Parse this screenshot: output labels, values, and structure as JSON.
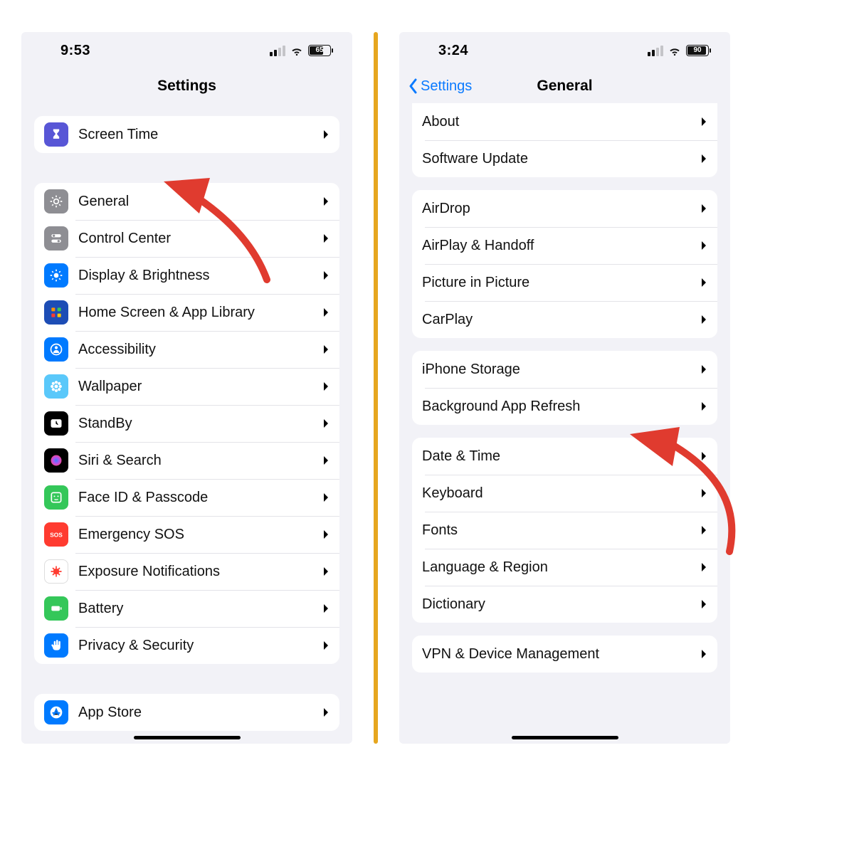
{
  "left": {
    "status": {
      "time": "9:53",
      "battery_pct": "65",
      "battery_fill_pct": 65,
      "signal_active_bars": 2
    },
    "title": "Settings",
    "group_top": [
      {
        "id": "screen-time",
        "label": "Screen Time",
        "bg": "bg-purple",
        "glyph": "hourglass"
      }
    ],
    "group_main": [
      {
        "id": "general",
        "label": "General",
        "bg": "bg-gray",
        "glyph": "gear"
      },
      {
        "id": "control-center",
        "label": "Control Center",
        "bg": "bg-gray",
        "glyph": "switches"
      },
      {
        "id": "display-brightness",
        "label": "Display & Brightness",
        "bg": "bg-blue",
        "glyph": "sun"
      },
      {
        "id": "home-screen",
        "label": "Home Screen & App Library",
        "bg": "bg-darkblue",
        "glyph": "grid"
      },
      {
        "id": "accessibility",
        "label": "Accessibility",
        "bg": "bg-blue",
        "glyph": "person"
      },
      {
        "id": "wallpaper",
        "label": "Wallpaper",
        "bg": "bg-teal",
        "glyph": "flower"
      },
      {
        "id": "standby",
        "label": "StandBy",
        "bg": "bg-black",
        "glyph": "clock"
      },
      {
        "id": "siri-search",
        "label": "Siri & Search",
        "bg": "bg-black",
        "glyph": "siri"
      },
      {
        "id": "face-id",
        "label": "Face ID & Passcode",
        "bg": "bg-green",
        "glyph": "face"
      },
      {
        "id": "emergency-sos",
        "label": "Emergency SOS",
        "bg": "bg-red",
        "glyph": "sos"
      },
      {
        "id": "exposure",
        "label": "Exposure Notifications",
        "bg": "bg-white",
        "glyph": "covid"
      },
      {
        "id": "battery",
        "label": "Battery",
        "bg": "bg-green",
        "glyph": "battery"
      },
      {
        "id": "privacy",
        "label": "Privacy & Security",
        "bg": "bg-blue",
        "glyph": "hand"
      }
    ],
    "group_bottom": [
      {
        "id": "app-store",
        "label": "App Store",
        "bg": "bg-blue",
        "glyph": "appstore"
      }
    ]
  },
  "right": {
    "status": {
      "time": "3:24",
      "battery_pct": "90",
      "battery_fill_pct": 90,
      "signal_active_bars": 2
    },
    "back_label": "Settings",
    "title": "General",
    "group1": [
      {
        "id": "about",
        "label": "About"
      },
      {
        "id": "software-update",
        "label": "Software Update"
      }
    ],
    "group2": [
      {
        "id": "airdrop",
        "label": "AirDrop"
      },
      {
        "id": "airplay",
        "label": "AirPlay & Handoff"
      },
      {
        "id": "pip",
        "label": "Picture in Picture"
      },
      {
        "id": "carplay",
        "label": "CarPlay"
      }
    ],
    "group3": [
      {
        "id": "storage",
        "label": "iPhone Storage"
      },
      {
        "id": "bg-refresh",
        "label": "Background App Refresh"
      }
    ],
    "group4": [
      {
        "id": "date-time",
        "label": "Date & Time"
      },
      {
        "id": "keyboard",
        "label": "Keyboard"
      },
      {
        "id": "fonts",
        "label": "Fonts"
      },
      {
        "id": "lang-region",
        "label": "Language & Region"
      },
      {
        "id": "dictionary",
        "label": "Dictionary"
      }
    ],
    "group5": [
      {
        "id": "vpn",
        "label": "VPN & Device Management"
      }
    ]
  },
  "colors": {
    "ios_blue": "#0a7aff",
    "arrow": "#e03b2f",
    "divider": "#e6a61f"
  }
}
